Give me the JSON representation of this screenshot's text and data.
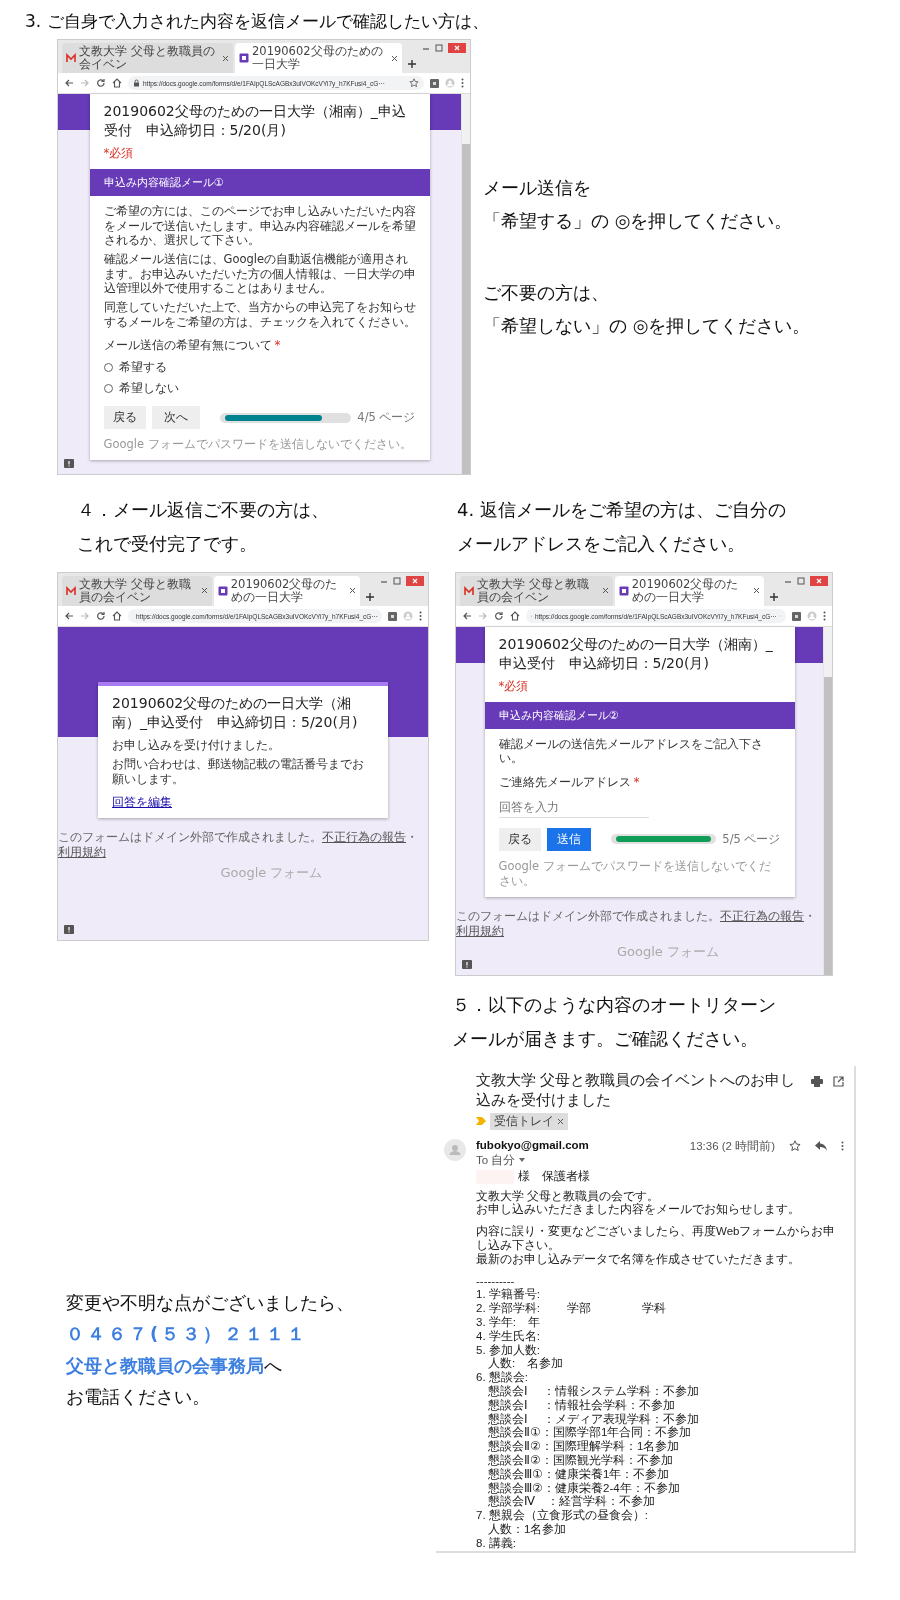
{
  "step3": {
    "heading": "3. ご自身で入力された内容を返信メールで確認したい方は、",
    "browser": {
      "tabs": [
        {
          "label": "文教大学 父母と教職員の会イベン",
          "kind": "mail",
          "selected": false
        },
        {
          "label": "20190602父母のための一日大学",
          "kind": "form",
          "selected": true
        }
      ],
      "url": "https://docs.google.com/forms/d/e/1FAIpQLScAGBx3uIVOKcVYi7y_h7KFusi4_cG···",
      "form": {
        "kind": "question",
        "title": "20190602父母のための一日大学（湘南）_申込受付　申込締切日：5/20(月)",
        "required_note": "*必須",
        "section": "申込み内容確認メール①",
        "paragraphs": [
          "ご希望の方には、このページでお申し込みいただいた内容をメールで送信いたします。申込み内容確認メールを希望されるか、選択して下さい。",
          "確認メール送信には、Googleの自動返信機能が適用されます。お申込みいただいた方の個人情報は、一日大学の申込管理以外で使用することはありません。",
          "同意していただいた上で、当方からの申込完了をお知らせするメールをご希望の方は、チェックを入れてください。"
        ],
        "question": {
          "label": "メール送信の希望有無について",
          "required_mark": "*"
        },
        "options": [
          {
            "label": "希望する",
            "selected": false
          },
          {
            "label": "希望しない",
            "selected": false
          }
        ],
        "buttons": [
          {
            "label": "戻る",
            "kind": "back"
          },
          {
            "label": "次へ",
            "kind": "next"
          }
        ],
        "progress": {
          "level": 0.8,
          "label": "4/5 ページ"
        },
        "footer": "Google フォームでパスワードを送信しないでください。"
      }
    },
    "callouts": [
      [
        "メール送信を",
        "「希望する」の ◎を押してください。"
      ],
      [
        "ご不要の方は、",
        "「希望しない」の ◎を押してください。"
      ]
    ]
  },
  "step4_done": {
    "heading": [
      "４．メール返信ご不要の方は、",
      "これで受付完了です。"
    ],
    "browser": {
      "tabs": [
        {
          "label": "文教大学 父母と教職員の会イベン",
          "kind": "mail",
          "selected": false
        },
        {
          "label": "20190602父母のための一日大学",
          "kind": "form",
          "selected": true
        }
      ],
      "url": "https://docs.google.com/forms/d/e/1FAIpQLScAGBx3uIVOKcVYi7y_h7KFusi4_cG···",
      "form": {
        "kind": "confirmation",
        "title": "20190602父母のための一日大学（湘南）_申込受付　申込締切日：5/20(月)",
        "paragraphs": [
          "お申し込みを受け付けました。",
          "お問い合わせは、郵送物記載の電話番号までお願いします。"
        ],
        "link": "回答を編集",
        "domain_note": {
          "text": "このフォームはドメイン外部で作成されました。",
          "links": [
            "不正行為の報告",
            "利用規約"
          ],
          "separator": "・"
        },
        "brand": [
          "Google",
          "フォーム"
        ]
      }
    }
  },
  "step4_mail": {
    "heading": [
      "4. 返信メールをご希望の方は、ご自分の",
      "メールアドレスをご記入ください。"
    ],
    "browser": {
      "tabs": [
        {
          "label": "文教大学 父母と教職員の会イベン",
          "kind": "mail",
          "selected": false
        },
        {
          "label": "20190602父母のための一日大学",
          "kind": "form",
          "selected": true
        }
      ],
      "url": "https://docs.google.com/forms/d/e/1FAIpQLScAGBx3uIVOKcVYi7y_h7KFusi4_cG···",
      "form": {
        "kind": "question",
        "title": "20190602父母のための一日大学（湘南）_申込受付　申込締切日：5/20(月)",
        "required_note": "*必須",
        "section": "申込み内容確認メール②",
        "paragraphs": [
          "確認メールの送信先メールアドレスをご記入下さい。"
        ],
        "question": {
          "label": "ご連絡先メールアドレス",
          "required_mark": "*"
        },
        "input": {
          "placeholder": "回答を入力"
        },
        "buttons": [
          {
            "label": "戻る",
            "kind": "back"
          },
          {
            "label": "送信",
            "kind": "submit"
          }
        ],
        "progress": {
          "level": 1,
          "label": "5/5 ページ"
        },
        "footer": "Google フォームでパスワードを送信しないでください。",
        "domain_note": {
          "text": "このフォームはドメイン外部で作成されました。",
          "links": [
            "不正行為の報告",
            "利用規約"
          ],
          "separator": "・"
        },
        "brand": [
          "Google",
          "フォーム"
        ]
      }
    }
  },
  "contact": [
    {
      "text": "変更や不明な点がございましたら、",
      "kind": "plain"
    },
    {
      "text": "０４６７(５３）２１１１",
      "kind": "emphasis"
    },
    {
      "text": "**父母と教職員の会事務局**へ",
      "kind": "plain"
    },
    {
      "text": "お電話ください。",
      "kind": "plain"
    }
  ],
  "step5": {
    "heading": [
      "５．以下のような内容のオートリターン",
      "メールが届きます。ご確認ください。"
    ],
    "email": {
      "subject": "文教大学 父母と教職員の会イベントへのお申し込みを受付けました",
      "label": "受信トレイ",
      "sender": "fubokyo@gmail.com",
      "recipient": "To 自分",
      "time": "13:36 (2 時間前)",
      "salutation": "様　保護者様",
      "paragraphs": [
        [
          "文教大学 父母と教職員の会です。",
          "お申し込みいただきました内容をメールでお知らせします。"
        ],
        [
          "内容に誤り・変更などございましたら、再度Webフォームからお申し込み下さい。",
          "最新のお申し込みデータで名簿を作成させていただきます。"
        ]
      ],
      "separator": "----------",
      "items": [
        {
          "text": "1. 学籍番号:"
        },
        {
          "text": "2. 学部学科:　　 学部　　　　 学科"
        },
        {
          "text": "3. 学年:　年"
        },
        {
          "text": "4. 学生氏名:"
        },
        {
          "text": "5. 参加人数:",
          "children": [
            {
              "text": "人数:　名参加"
            }
          ]
        },
        {
          "text": "6. 懇談会:",
          "children": [
            {
              "text": "懇談会Ⅰ　 ：情報システム学科：不参加"
            },
            {
              "text": "懇談会Ⅰ　 ：情報社会学科：不参加"
            },
            {
              "text": "懇談会Ⅰ　 ：メディア表現学科：不参加"
            },
            {
              "text": "懇談会Ⅱ①：国際学部1年合同：不参加"
            },
            {
              "text": "懇談会Ⅱ②：国際理解学科：1名参加"
            },
            {
              "text": "懇談会Ⅱ②：国際観光学科：不参加"
            },
            {
              "text": "懇談会Ⅲ①：健康栄養1年：不参加"
            },
            {
              "text": "懇談会Ⅲ②：健康栄養2-4年：不参加"
            },
            {
              "text": "懇談会Ⅳ　：経営学科：不参加"
            }
          ]
        },
        {
          "text": "7. 懇親会（立食形式の昼食会）:",
          "children": [
            {
              "text": "人数：1名参加"
            }
          ]
        },
        {
          "text": "8. 講義:"
        }
      ]
    }
  }
}
